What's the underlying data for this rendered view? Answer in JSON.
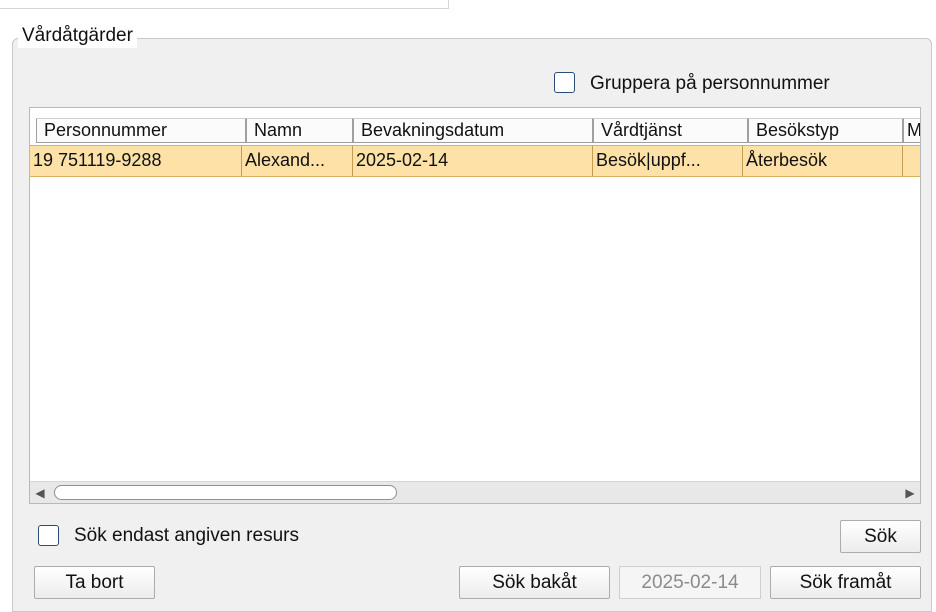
{
  "group": {
    "title": "Vårdåtgärder"
  },
  "options": {
    "group_by_personnummer_label": "Gruppera på personnummer",
    "search_only_resource_label": "Sök endast angiven resurs"
  },
  "table": {
    "columns": [
      "Personnummer",
      "Namn",
      "Bevakningsdatum",
      "Vårdtjänst",
      "Besökstyp",
      "M"
    ],
    "rows": [
      [
        "19 751119-9288",
        "Alexand...",
        "2025-02-14",
        "Besök|uppf...",
        "Återbesök",
        ""
      ]
    ]
  },
  "buttons": {
    "search": "Sök",
    "remove": "Ta bort",
    "search_back": "Sök bakåt",
    "search_forward": "Sök framåt"
  },
  "date_field": {
    "value": "2025-02-14"
  },
  "icons": {
    "scroll_left": "scroll-left-arrow-icon",
    "scroll_right": "scroll-right-arrow-icon"
  },
  "colors": {
    "selected_row": "#fde1a6",
    "checkbox_border": "#2b4b78"
  }
}
